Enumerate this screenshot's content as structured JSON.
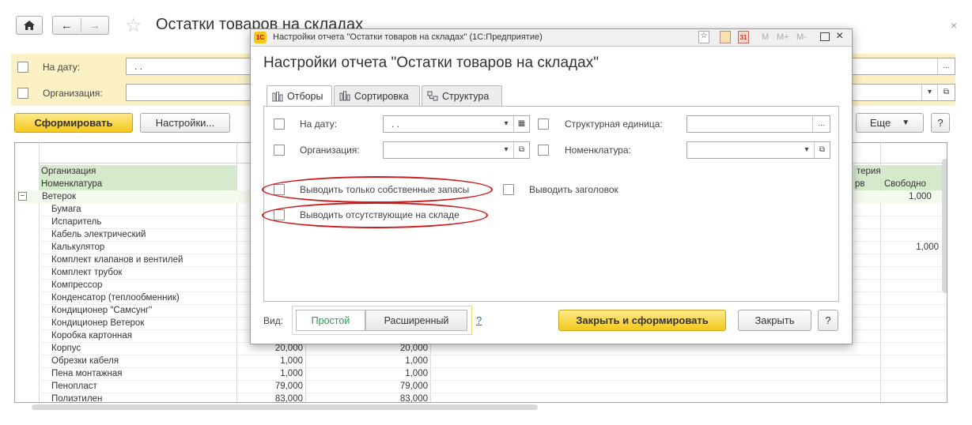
{
  "window": {
    "title": "Остатки товаров на складах",
    "close_glyph": "×"
  },
  "filters": {
    "date_label": "На дату:",
    "date_value": ". .",
    "org_label": "Организация:",
    "select_glyph": "...",
    "dropdown_glyph": "▾",
    "open_glyph": "⧉"
  },
  "toolbar": {
    "generate_label": "Сформировать",
    "settings_label": "Настройки...",
    "more_label": "Еще",
    "help_label": "?"
  },
  "report": {
    "header_org": "Организация",
    "header_nom": "Номенклатура",
    "header_right_group": "терия",
    "header_right_col1": "рв",
    "header_right_col2": "Свободно",
    "group_name": "Ветерок",
    "group_value": "1,000",
    "rows": [
      {
        "name": "Бумага",
        "c1": "",
        "c2": "",
        "free": ""
      },
      {
        "name": "Испаритель",
        "c1": "",
        "c2": "",
        "free": ""
      },
      {
        "name": "Кабель электрический",
        "c1": "",
        "c2": "",
        "free": ""
      },
      {
        "name": "Калькулятор",
        "c1": "",
        "c2": "",
        "free": "1,000"
      },
      {
        "name": "Комплект клапанов и вентилей",
        "c1": "",
        "c2": "",
        "free": ""
      },
      {
        "name": "Комплект трубок",
        "c1": "",
        "c2": "",
        "free": ""
      },
      {
        "name": "Компрессор",
        "c1": "",
        "c2": "",
        "free": ""
      },
      {
        "name": "Конденсатор (теплообменник)",
        "c1": "",
        "c2": "",
        "free": ""
      },
      {
        "name": "Кондиционер \"Самсунг\"",
        "c1": "",
        "c2": "",
        "free": ""
      },
      {
        "name": "Кондиционер Ветерок",
        "c1": "",
        "c2": "",
        "free": ""
      },
      {
        "name": "Коробка картонная",
        "c1": "",
        "c2": "",
        "free": ""
      },
      {
        "name": "Корпус",
        "c1": "20,000",
        "c2": "20,000",
        "free": ""
      },
      {
        "name": "Обрезки кабеля",
        "c1": "1,000",
        "c2": "1,000",
        "free": ""
      },
      {
        "name": "Пена монтажная",
        "c1": "1,000",
        "c2": "1,000",
        "free": ""
      },
      {
        "name": "Пенопласт",
        "c1": "79,000",
        "c2": "79,000",
        "free": ""
      },
      {
        "name": "Полиэтилен",
        "c1": "83,000",
        "c2": "83,000",
        "free": ""
      }
    ]
  },
  "dialog": {
    "window_title": "Настройки отчета \"Остатки товаров на складах\" (1С:Предприятие)",
    "app_badge": "1С",
    "title_tools": [
      "M",
      "M+",
      "M-"
    ],
    "heading": "Настройки отчета \"Остатки товаров на складах\"",
    "tabs": [
      {
        "label": "Отборы"
      },
      {
        "label": "Сортировка"
      },
      {
        "label": "Структура"
      }
    ],
    "date_label": "На дату:",
    "date_value": ". .",
    "org_label": "Организация:",
    "struct_label": "Структурная единица:",
    "nom_label": "Номенклатура:",
    "own_stock_label": "Выводить только собственные запасы",
    "header_label": "Выводить заголовок",
    "missing_label": "Выводить отсутствующие на складе",
    "view_label": "Вид:",
    "view_simple": "Простой",
    "view_extended": "Расширенный",
    "help_link": "?",
    "close_generate_label": "Закрыть и сформировать",
    "close_label": "Закрыть",
    "help_button": "?"
  },
  "colors": {
    "accent_yellow": "#f4c81b",
    "filter_panel": "#fbf1c4",
    "header_green": "#d5eacc",
    "highlight_red": "#d01a1a"
  }
}
